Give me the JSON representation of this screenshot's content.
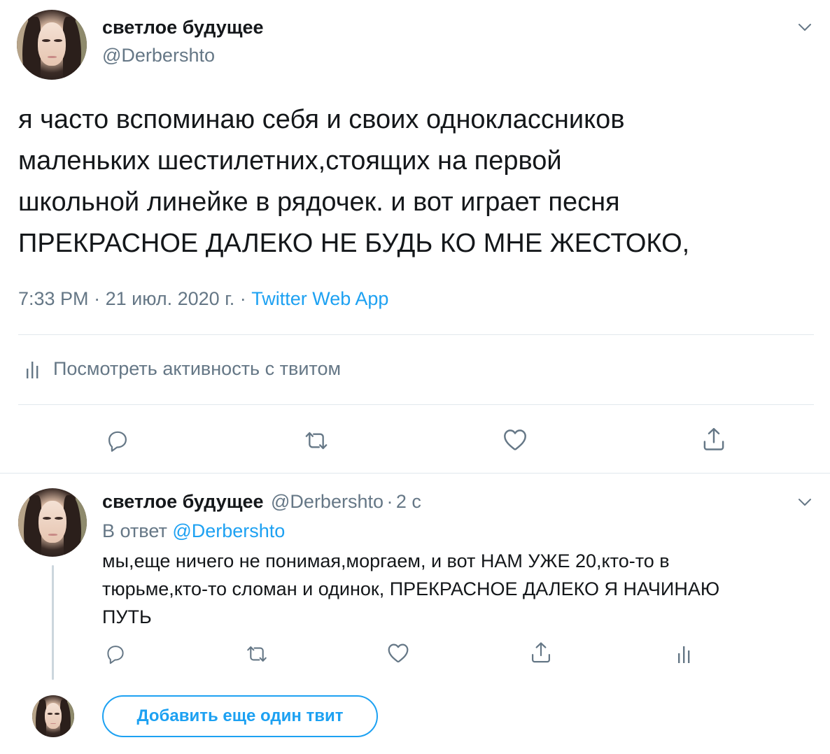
{
  "main_tweet": {
    "author_name": "светлое будущее",
    "author_handle": "@Derbershto",
    "text_lines": [
      "я часто вспоминаю себя и своих одноклассников",
      "маленьких шестилетних,стоящих на первой",
      "школьной линейке в рядочек. и вот играет песня",
      "ПРЕКРАСНОЕ ДАЛЕКО НЕ БУДЬ КО МНЕ ЖЕСТОКО,"
    ],
    "time": "7:33 PM",
    "date": "21 июл. 2020 г.",
    "separator": "·",
    "source": "Twitter Web App",
    "activity_label": "Посмотреть активность с твитом",
    "actions": [
      "reply-icon",
      "retweet-icon",
      "like-icon",
      "share-icon"
    ]
  },
  "reply_tweet": {
    "author_name": "светлое будущее",
    "author_handle": "@Derbershto",
    "age": "2 с",
    "separator": "·",
    "reply_prefix": "В ответ",
    "reply_to_handle": "@Derbershto",
    "text_lines": [
      "мы,еще ничего не понимая,моргаем, и вот НАМ УЖЕ 20,кто-то в",
      "тюрьме,кто-то сломан и одинок, ПРЕКРАСНОЕ ДАЛЕКО Я НАЧИНАЮ",
      "ПУТЬ"
    ],
    "actions": [
      "reply-icon",
      "retweet-icon",
      "like-icon",
      "share-icon",
      "analytics-icon"
    ]
  },
  "composer": {
    "add_tweet_label": "Добавить еще один твит"
  },
  "colors": {
    "accent": "#1da1f2",
    "secondary_text": "#657786",
    "primary_text": "#14171a",
    "divider": "#e1e8ed"
  }
}
